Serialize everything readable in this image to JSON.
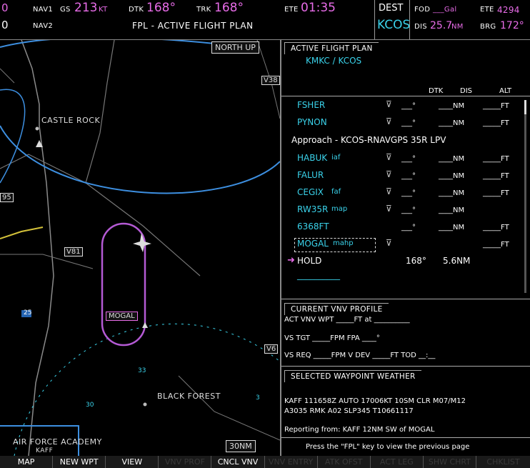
{
  "topbar": {
    "nav1_freq": "0",
    "nav2_freq": "0",
    "nav1_label": "NAV1",
    "nav2_label": "NAV2",
    "gs_label": "GS",
    "gs_value": "213",
    "gs_unit": "KT",
    "dtk_label": "DTK",
    "dtk_value": "168°",
    "trk_label": "TRK",
    "trk_value": "168°",
    "ete_label": "ETE",
    "ete_value": "01:35",
    "page_title": "FPL - ACTIVE FLIGHT PLAN",
    "dest_label": "DEST",
    "dest_value": "KCOS",
    "fod_label": "FOD",
    "fod_value": "___Gal",
    "ete2_label": "ETE",
    "ete2_value": "4294",
    "dis_label": "DIS",
    "dis_value": "25.7",
    "dis_unit": "NM",
    "brg_label": "BRG",
    "brg_value": "172°"
  },
  "map": {
    "orientation": "NORTH UP",
    "range": "30NM",
    "labels": {
      "castle_rock": "CASTLE ROCK",
      "black_forest": "BLACK FOREST",
      "air_force": "AIR FORCE ACADEMY",
      "kaff": "KAFF",
      "mogal": "MOGAL",
      "v38": "V38",
      "v81": "V81",
      "v6": "V6",
      "hwy25": "25",
      "hwy95": "95",
      "ring_33": "33",
      "ring_30": "30",
      "ring_3": "3"
    }
  },
  "flightplan": {
    "title": "ACTIVE FLIGHT PLAN",
    "route": "KMKC / KCOS",
    "columns": [
      "DTK",
      "DIS",
      "ALT"
    ],
    "rows": [
      {
        "name": "FSHER",
        "tag": "",
        "dtk": "___°",
        "dis": "____NM",
        "alt": "_____FT",
        "arrow": false
      },
      {
        "name": "PYNON",
        "tag": "",
        "dtk": "___°",
        "dis": "____NM",
        "alt": "_____FT",
        "arrow": false
      },
      {
        "name": "HABUK",
        "tag": "iaf",
        "dtk": "___°",
        "dis": "____NM",
        "alt": "_____FT",
        "arrow": false
      },
      {
        "name": "FALUR",
        "tag": "",
        "dtk": "___°",
        "dis": "____NM",
        "alt": "_____FT",
        "arrow": false
      },
      {
        "name": "CEGIX",
        "tag": "faf",
        "dtk": "___°",
        "dis": "____NM",
        "alt": "_____FT",
        "arrow": false
      },
      {
        "name": "RW35R",
        "tag": "map",
        "dtk": "___°",
        "dis": "____NM",
        "alt": "",
        "arrow": false
      },
      {
        "name": "6368FT",
        "tag": "",
        "dtk": "___°",
        "dis": "____NM",
        "alt": "_____FT",
        "arrow": false
      },
      {
        "name": "MOGAL",
        "tag": "mahp",
        "dtk": "",
        "dis": "",
        "alt": "_____FT",
        "arrow": false
      },
      {
        "name": "HOLD",
        "tag": "",
        "dtk": "168°",
        "dis": "5.6NM",
        "alt": "",
        "arrow": true
      }
    ],
    "approach": "Approach - KCOS-RNAVGPS 35R LPV",
    "dashes": "__________"
  },
  "vnv": {
    "title": "CURRENT VNV PROFILE",
    "act_wpt": "ACT VNV WPT _____FT at __________",
    "vs_tgt": "VS TGT _____FPM  FPA  ____°",
    "vs_req": "VS REQ _____FPM  V DEV _____FT  TOD __:__"
  },
  "weather": {
    "title": "SELECTED WAYPOINT WEATHER",
    "metar1": "KAFF 111658Z AUTO 17006KT 10SM CLR M07/M12",
    "metar2": "A3035 RMK A02 SLP345 T10661117",
    "reporting": "Reporting from:  KAFF    12NM  SW  of  MOGAL",
    "footer": "Press the \"FPL\" key to view the previous page"
  },
  "softkeys": [
    {
      "label": "MAP",
      "enabled": true
    },
    {
      "label": "NEW WPT",
      "enabled": true
    },
    {
      "label": "VIEW",
      "enabled": true
    },
    {
      "label": "VNV PROF",
      "enabled": false
    },
    {
      "label": "CNCL VNV",
      "enabled": true
    },
    {
      "label": "VNV ENTRY",
      "enabled": false
    },
    {
      "label": "ATK OFST",
      "enabled": false
    },
    {
      "label": "ACT LEG",
      "enabled": false
    },
    {
      "label": "SHW CHRT",
      "enabled": false
    },
    {
      "label": "CHKLIST",
      "enabled": false
    }
  ],
  "colors": {
    "cyan": "#3ad2ea",
    "magenta": "#e86ce8",
    "airway": "#3d8fe0"
  }
}
